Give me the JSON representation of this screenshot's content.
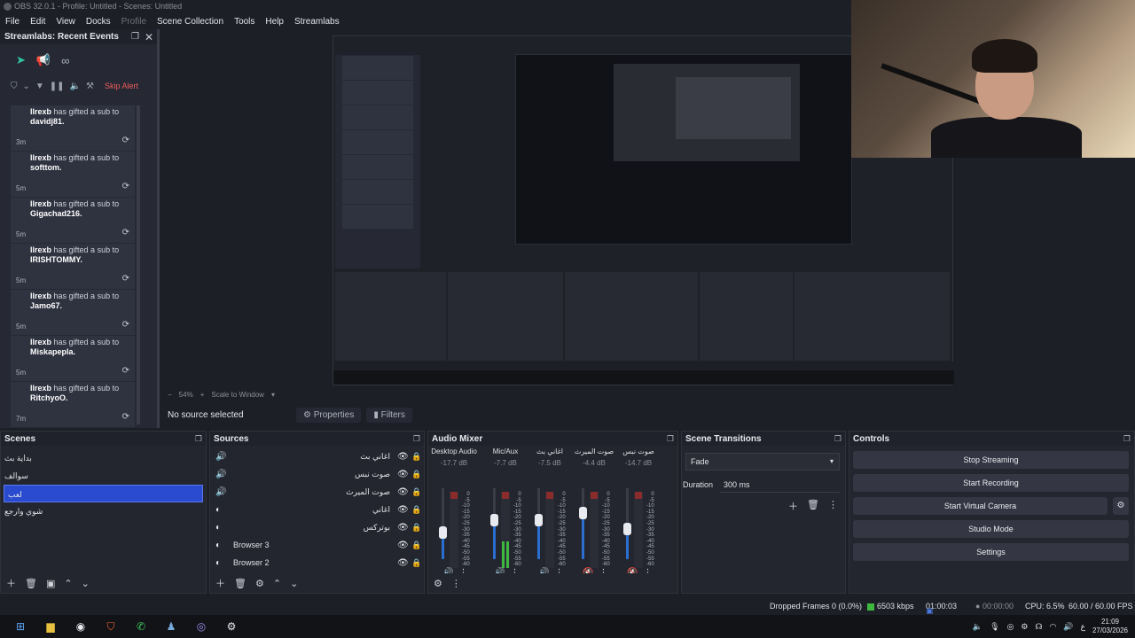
{
  "window": {
    "title": "OBS 32.0.1 - Profile: Untitled - Scenes: Untitled"
  },
  "menu": [
    "File",
    "Edit",
    "View",
    "Docks",
    "Profile",
    "Scene Collection",
    "Tools",
    "Help",
    "Streamlabs"
  ],
  "events": {
    "title": "Streamlabs: Recent Events",
    "skip_label": "Skip Alert",
    "items": [
      {
        "user": "llrexb",
        "action": "has gifted a sub to",
        "target": "davidj81.",
        "time": "3m"
      },
      {
        "user": "llrexb",
        "action": "has gifted a sub to",
        "target": "softtom.",
        "time": "5m"
      },
      {
        "user": "llrexb",
        "action": "has gifted a sub to",
        "target": "Gigachad216.",
        "time": "5m"
      },
      {
        "user": "llrexb",
        "action": "has gifted a sub to",
        "target": "IRISHTOMMY.",
        "time": "5m"
      },
      {
        "user": "llrexb",
        "action": "has gifted a sub to",
        "target": "Jamo67.",
        "time": "5m"
      },
      {
        "user": "llrexb",
        "action": "has gifted a sub to",
        "target": "Miskapepla.",
        "time": "5m"
      },
      {
        "user": "llrexb",
        "action": "has gifted a sub to",
        "target": "RitchyoO.",
        "time": "7m"
      }
    ]
  },
  "preview": {
    "zoom": "54%",
    "scale_mode": "Scale to Window"
  },
  "source_bar": {
    "no_source": "No source selected",
    "properties": "Properties",
    "filters": "Filters"
  },
  "scenes": {
    "title": "Scenes",
    "items": [
      "بداية بث",
      "سوالف",
      "لعب",
      "شوي وارجع"
    ],
    "selected_index": 2
  },
  "sources": {
    "title": "Sources",
    "items": [
      {
        "name": "اغاني بث",
        "icon": "speaker-icon"
      },
      {
        "name": "صوت نبس",
        "icon": "speaker-icon"
      },
      {
        "name": "صوت الميرث",
        "icon": "speaker-icon"
      },
      {
        "name": "اغاني",
        "icon": "globe-icon"
      },
      {
        "name": "بوتركس",
        "icon": "globe-icon"
      },
      {
        "name": "Browser 3",
        "icon": "globe-icon"
      },
      {
        "name": "Browser 2",
        "icon": "globe-icon"
      }
    ]
  },
  "mixer": {
    "title": "Audio Mixer",
    "channels": [
      {
        "name": "Desktop Audio",
        "db": "-17.7 dB",
        "volume": 0.37,
        "level": 0.0,
        "muted": false
      },
      {
        "name": "Mic/Aux",
        "db": "-7.7 dB",
        "volume": 0.55,
        "level": 0.35,
        "muted": false
      },
      {
        "name": "اغاني بث",
        "db": "-7.5 dB",
        "volume": 0.55,
        "level": 0.0,
        "muted": false
      },
      {
        "name": "صوت الميرث",
        "db": "-4.4 dB",
        "volume": 0.65,
        "level": 0.0,
        "muted": true
      },
      {
        "name": "صوت نبس",
        "db": "-14.7 dB",
        "volume": 0.42,
        "level": 0.0,
        "muted": true
      }
    ],
    "scale": [
      "0",
      "-5",
      "-10",
      "-15",
      "-20",
      "-25",
      "-30",
      "-35",
      "-40",
      "-45",
      "-50",
      "-55",
      "-60"
    ]
  },
  "transitions": {
    "title": "Scene Transitions",
    "type": "Fade",
    "duration_label": "Duration",
    "duration": "300 ms"
  },
  "controls": {
    "title": "Controls",
    "buttons": [
      "Stop Streaming",
      "Start Recording",
      "Start Virtual Camera",
      "Studio Mode",
      "Settings"
    ]
  },
  "status": {
    "dropped": "Dropped Frames 0 (0.0%)",
    "bitrate": "6503 kbps",
    "live_time": "01:00:03",
    "rec_time": "00:00:00",
    "cpu": "CPU: 6.5%",
    "fps": "60.00 / 60.00 FPS"
  },
  "taskbar": {
    "time": "21:09",
    "date": "27/03/2026",
    "lang": "ع"
  },
  "colors": {
    "accent": "#2a4bd0",
    "meter_green": "#3fb83f",
    "alert_red": "#f05a5a",
    "events_accent": "#31c3a2"
  }
}
